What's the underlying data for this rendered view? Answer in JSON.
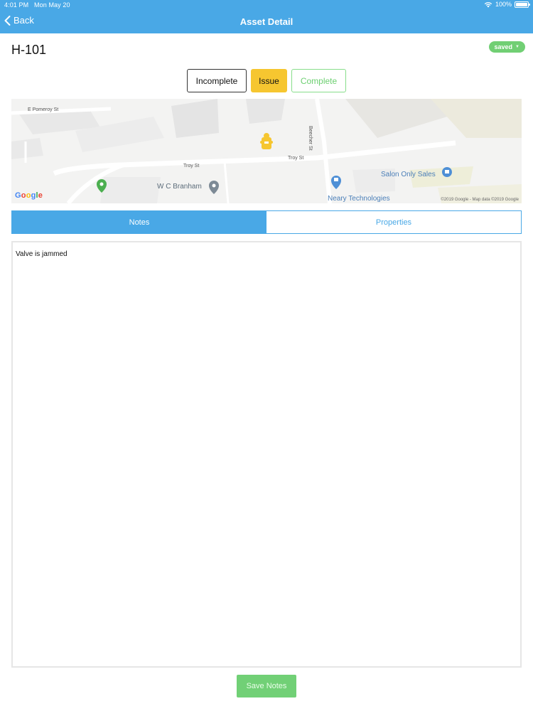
{
  "status_bar": {
    "time": "4:01 PM",
    "date": "Mon May 20",
    "battery": "100%",
    "wifi_icon": "wifi-icon",
    "battery_icon": "battery-icon"
  },
  "nav": {
    "back_label": "Back",
    "title": "Asset Detail"
  },
  "asset": {
    "id": "H-101",
    "save_state": "saved"
  },
  "status_options": {
    "incomplete": "Incomplete",
    "issue": "Issue",
    "complete": "Complete",
    "selected": "Issue"
  },
  "map": {
    "labels": {
      "e_pomeroy": "E Pomeroy St",
      "troy_st_1": "Troy St",
      "troy_st_2": "Troy St",
      "beecher": "Beecher St",
      "wc_branham": "W C Branham",
      "salon": "Salon Only Sales",
      "neary": "Neary Technologies"
    },
    "logo_letters": [
      "G",
      "o",
      "o",
      "g",
      "l",
      "e"
    ],
    "copyright": "©2019 Google - Map data ©2019 Google",
    "marker_icon": "fire-hydrant-icon"
  },
  "tabs": {
    "notes": "Notes",
    "properties": "Properties",
    "active": "notes"
  },
  "notes": {
    "text": "Valve is jammed"
  },
  "actions": {
    "save_notes": "Save Notes"
  },
  "colors": {
    "primary": "#49a8e6",
    "success": "#71cf74",
    "warning": "#f6c630"
  }
}
